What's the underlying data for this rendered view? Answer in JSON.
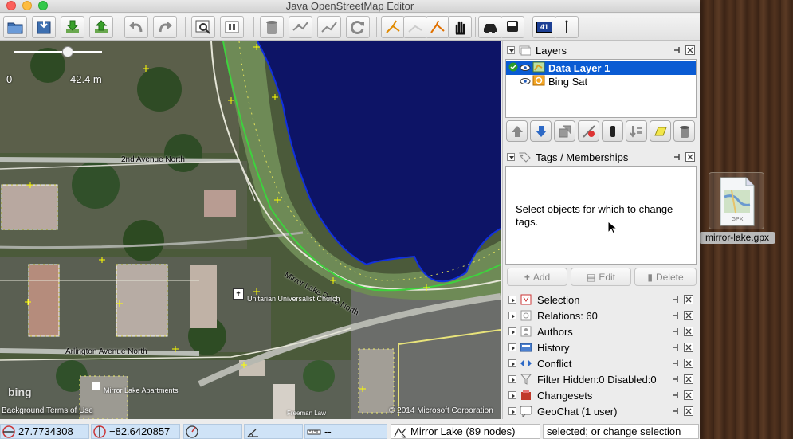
{
  "window": {
    "title": "Java OpenStreetMap Editor"
  },
  "toolbar": {
    "buttons": [
      "open-file",
      "save",
      "download",
      "upload",
      "undo",
      "redo",
      "zoom",
      "preferences",
      "delete",
      "split-way",
      "combine-way",
      "refresh",
      "draw-mode",
      "select-mode",
      "select-lasso",
      "move-mode",
      "car",
      "bus",
      "speed-sign",
      "pin"
    ],
    "speed_label": "41"
  },
  "map": {
    "scale_zero": "0",
    "scale_label": "42.4 m",
    "labels": {
      "avenue_2nd": "2nd Avenue North",
      "mirror_lake_drive": "Mirror Lake Drive North",
      "unitarian": "Unitarian Universalist Church",
      "arlington": "Arlington Avenue North",
      "apartments": "Mirror Lake Apartments",
      "freeman": "Freeman Law"
    },
    "bing_logo": "bing",
    "background_terms": "Background Terms of Use",
    "copyright": "© 2014 Microsoft Corporation"
  },
  "layers": {
    "title": "Layers",
    "items": [
      {
        "name": "Data Layer 1",
        "selected": true,
        "active": true
      },
      {
        "name": "Bing Sat",
        "selected": false,
        "active": false
      }
    ]
  },
  "tags": {
    "title": "Tags / Memberships",
    "empty_message": "Select objects for which to change tags.",
    "add_label": "Add",
    "edit_label": "Edit",
    "delete_label": "Delete"
  },
  "panels": [
    {
      "label": "Selection",
      "icon": "selection-icon"
    },
    {
      "label": "Relations: 60",
      "icon": "relations-icon"
    },
    {
      "label": "Authors",
      "icon": "authors-icon"
    },
    {
      "label": "History",
      "icon": "history-icon"
    },
    {
      "label": "Conflict",
      "icon": "conflict-icon"
    },
    {
      "label": "Filter Hidden:0 Disabled:0",
      "icon": "filter-icon"
    },
    {
      "label": "Changesets",
      "icon": "changesets-icon"
    },
    {
      "label": "GeoChat (1 user)",
      "icon": "geochat-icon"
    }
  ],
  "status": {
    "lat": "27.7734308",
    "lon": "−82.6420857",
    "heading": "",
    "angle": "",
    "distance": "--",
    "name": "Mirror Lake (89 nodes)",
    "help": "selected; or change selection"
  },
  "desktop": {
    "file_name": "mirror-lake.gpx",
    "file_type": "GPX"
  },
  "colors": {
    "selection_blue": "#0a5bd3",
    "water": "#0d1466",
    "status_field": "#cfe3f7"
  }
}
